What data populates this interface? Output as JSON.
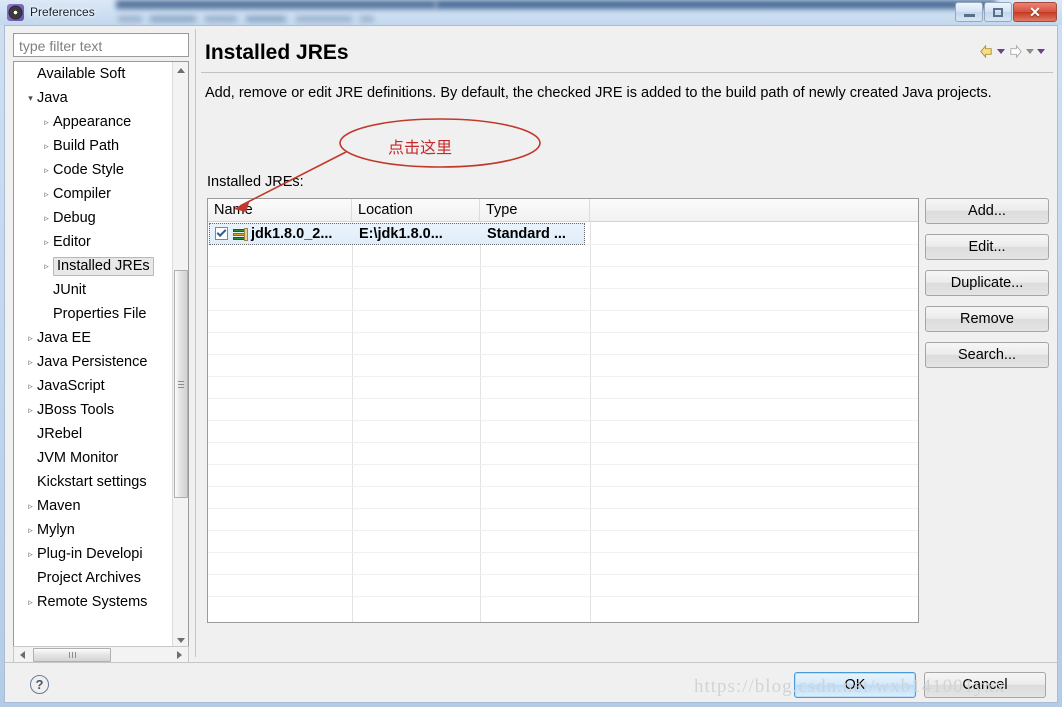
{
  "window": {
    "title": "Preferences",
    "icon": "eclipse-preferences-icon",
    "controls": {
      "minimize": "minimize-icon",
      "maximize": "maximize-icon",
      "close": "✕"
    }
  },
  "sidebar": {
    "filter": {
      "placeholder": "type filter text",
      "value": ""
    },
    "items": [
      {
        "label": "Available Soft",
        "level": 1,
        "twisty": "none",
        "selected": false
      },
      {
        "label": "Java",
        "level": 1,
        "twisty": "expanded",
        "selected": false
      },
      {
        "label": "Appearance",
        "level": 2,
        "twisty": "collapsed",
        "selected": false
      },
      {
        "label": "Build Path",
        "level": 2,
        "twisty": "collapsed",
        "selected": false
      },
      {
        "label": "Code Style",
        "level": 2,
        "twisty": "collapsed",
        "selected": false
      },
      {
        "label": "Compiler",
        "level": 2,
        "twisty": "collapsed",
        "selected": false
      },
      {
        "label": "Debug",
        "level": 2,
        "twisty": "collapsed",
        "selected": false
      },
      {
        "label": "Editor",
        "level": 2,
        "twisty": "collapsed",
        "selected": false
      },
      {
        "label": "Installed JREs",
        "level": 2,
        "twisty": "collapsed",
        "selected": true
      },
      {
        "label": "JUnit",
        "level": 2,
        "twisty": "none",
        "selected": false
      },
      {
        "label": "Properties File",
        "level": 2,
        "twisty": "none",
        "selected": false
      },
      {
        "label": "Java EE",
        "level": 1,
        "twisty": "collapsed",
        "selected": false
      },
      {
        "label": "Java Persistence",
        "level": 1,
        "twisty": "collapsed",
        "selected": false
      },
      {
        "label": "JavaScript",
        "level": 1,
        "twisty": "collapsed",
        "selected": false
      },
      {
        "label": "JBoss Tools",
        "level": 1,
        "twisty": "collapsed",
        "selected": false
      },
      {
        "label": "JRebel",
        "level": 1,
        "twisty": "none",
        "selected": false
      },
      {
        "label": "JVM Monitor",
        "level": 1,
        "twisty": "none",
        "selected": false
      },
      {
        "label": "Kickstart settings",
        "level": 1,
        "twisty": "none",
        "selected": false
      },
      {
        "label": "Maven",
        "level": 1,
        "twisty": "collapsed",
        "selected": false
      },
      {
        "label": "Mylyn",
        "level": 1,
        "twisty": "collapsed",
        "selected": false
      },
      {
        "label": "Plug-in Developi",
        "level": 1,
        "twisty": "collapsed",
        "selected": false
      },
      {
        "label": "Project Archives",
        "level": 1,
        "twisty": "none",
        "selected": false
      },
      {
        "label": "Remote Systems",
        "level": 1,
        "twisty": "collapsed",
        "selected": false
      }
    ]
  },
  "content": {
    "title": "Installed JREs",
    "description": "Add, remove or edit JRE definitions. By default, the checked JRE is added to the build path of newly created Java projects.",
    "list_label": "Installed JREs:",
    "nav": {
      "back": "back-arrow-icon",
      "forward": "forward-arrow-icon"
    },
    "table": {
      "columns": [
        "Name",
        "Location",
        "Type"
      ],
      "rows": [
        {
          "checked": true,
          "name": "jdk1.8.0_2...",
          "location": "E:\\jdk1.8.0...",
          "type": "Standard ...",
          "selected": true
        }
      ]
    },
    "side_buttons": [
      {
        "label": "Add...",
        "name": "add-button"
      },
      {
        "label": "Edit...",
        "name": "edit-button"
      },
      {
        "label": "Duplicate...",
        "name": "duplicate-button"
      },
      {
        "label": "Remove",
        "name": "remove-button"
      },
      {
        "label": "Search...",
        "name": "search-button"
      }
    ]
  },
  "footer": {
    "help": "?",
    "ok": "OK",
    "cancel": "Cancel"
  },
  "annotation": {
    "text": "点击这里",
    "color": "#c62828"
  },
  "watermark": "https://blog.csdn.net/wxb141001yxx"
}
